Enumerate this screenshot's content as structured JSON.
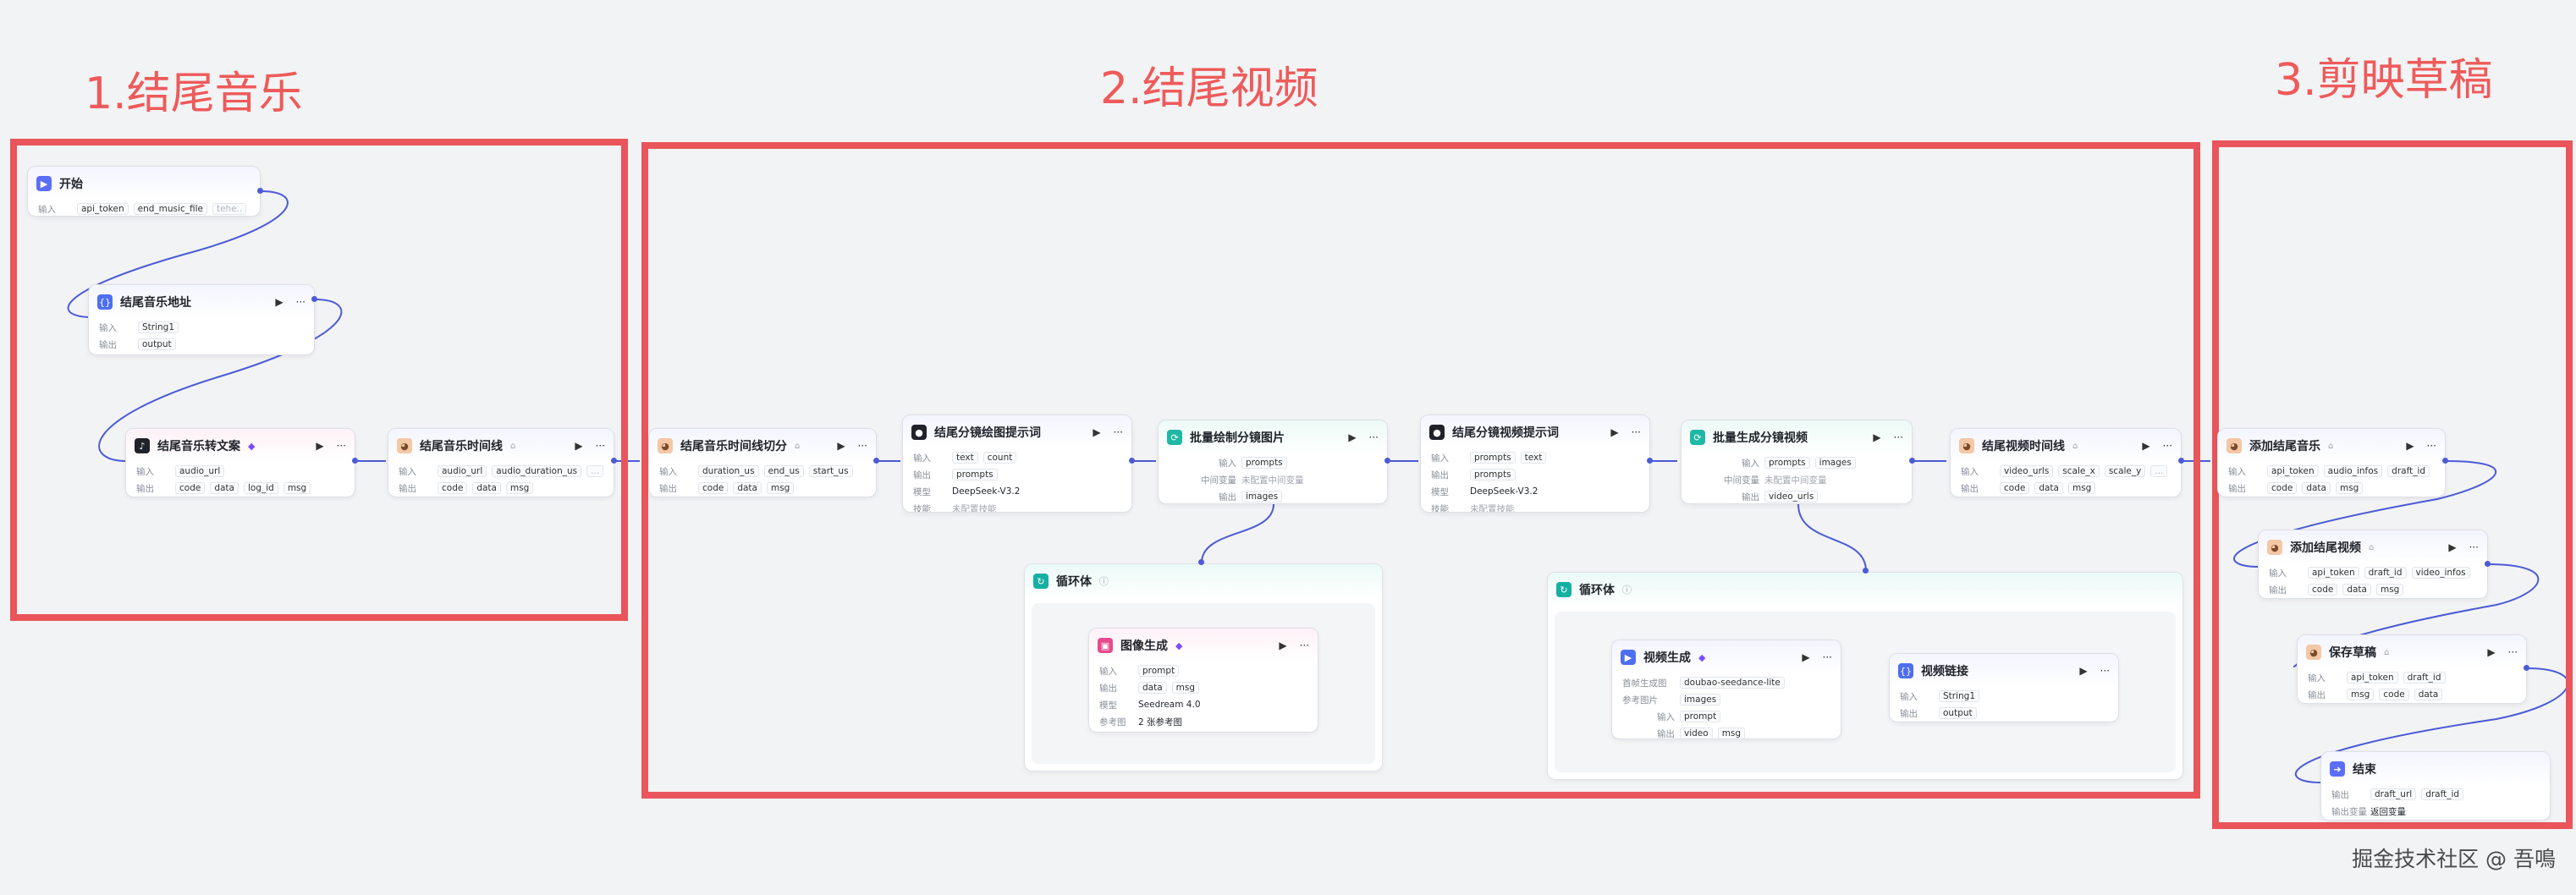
{
  "sections": [
    {
      "title": "1.结尾音乐"
    },
    {
      "title": "2.结尾视频"
    },
    {
      "title": "3.剪映草稿"
    }
  ],
  "labels": {
    "input": "输入",
    "output": "输出",
    "model": "模型",
    "skill": "技能",
    "mid_var": "中间变量",
    "ref_image": "参考图",
    "frame_image": "首帧生成图",
    "ref_image2": "参考图片",
    "output_var": "输出变量"
  },
  "nodes": {
    "start": {
      "title": "开始",
      "inputs": [
        "api_token",
        "end_music_file",
        "tehe.."
      ]
    },
    "music_url": {
      "title": "结尾音乐地址",
      "input": "String1",
      "output": "output"
    },
    "music_to_text": {
      "title": "结尾音乐转文案",
      "input": "audio_url",
      "outputs": [
        "code",
        "data",
        "log_id",
        "msg"
      ]
    },
    "music_timeline": {
      "title": "结尾音乐时间线",
      "inputs": [
        "audio_url",
        "audio_duration_us",
        "..."
      ],
      "outputs": [
        "code",
        "data",
        "msg"
      ]
    },
    "timeline_split": {
      "title": "结尾音乐时间线切分",
      "inputs": [
        "duration_us",
        "end_us",
        "start_us"
      ],
      "outputs": [
        "code",
        "data",
        "msg"
      ]
    },
    "img_prompt": {
      "title": "结尾分镜绘图提示词",
      "inputs": [
        "text",
        "count"
      ],
      "output": "prompts",
      "model": "DeepSeek-V3.2",
      "skill": "未配置技能"
    },
    "batch_images": {
      "title": "批量绘制分镜图片",
      "input": "prompts",
      "mid_var": "未配置中间变量",
      "output": "images"
    },
    "video_prompt": {
      "title": "结尾分镜视频提示词",
      "inputs": [
        "prompts",
        "text"
      ],
      "output": "prompts",
      "model": "DeepSeek-V3.2",
      "skill": "未配置技能"
    },
    "batch_videos": {
      "title": "批量生成分镜视频",
      "inputs": [
        "prompts",
        "images"
      ],
      "mid_var": "未配置中间变量",
      "output": "video_urls"
    },
    "video_timeline": {
      "title": "结尾视频时间线",
      "inputs": [
        "video_urls",
        "scale_x",
        "scale_y",
        "..."
      ],
      "outputs": [
        "code",
        "data",
        "msg"
      ]
    },
    "loop1": {
      "title": "循环体"
    },
    "image_gen": {
      "title": "图像生成",
      "input": "prompt",
      "outputs": [
        "data",
        "msg"
      ],
      "model": "Seedream 4.0",
      "ref": "2 张参考图"
    },
    "loop2": {
      "title": "循环体"
    },
    "video_gen": {
      "title": "视频生成",
      "frame_model": "doubao-seedance-lite",
      "ref": "images",
      "input": "prompt",
      "outputs": [
        "video",
        "msg"
      ]
    },
    "video_link": {
      "title": "视频链接",
      "input": "String1",
      "output": "output"
    },
    "add_music": {
      "title": "添加结尾音乐",
      "inputs": [
        "api_token",
        "audio_infos",
        "draft_id"
      ],
      "outputs": [
        "code",
        "data",
        "msg"
      ]
    },
    "add_video": {
      "title": "添加结尾视频",
      "inputs": [
        "api_token",
        "draft_id",
        "video_infos"
      ],
      "outputs": [
        "code",
        "data",
        "msg"
      ]
    },
    "save_draft": {
      "title": "保存草稿",
      "inputs": [
        "api_token",
        "draft_id"
      ],
      "outputs": [
        "msg",
        "code",
        "data"
      ]
    },
    "end": {
      "title": "结束",
      "outputs": [
        "draft_url",
        "draft_id"
      ],
      "return": "返回变量"
    }
  },
  "watermark": "掘金技术社区 @ 吾鳴",
  "colors": {
    "frame": "#e9555a",
    "wire": "#4b5bd6",
    "title": "#ef5a5a"
  },
  "icons": [
    "flag-icon",
    "code-icon",
    "tiktok-icon",
    "plugin-cat-icon",
    "llm-icon",
    "loop-icon",
    "image-icon",
    "video-icon",
    "end-icon"
  ]
}
